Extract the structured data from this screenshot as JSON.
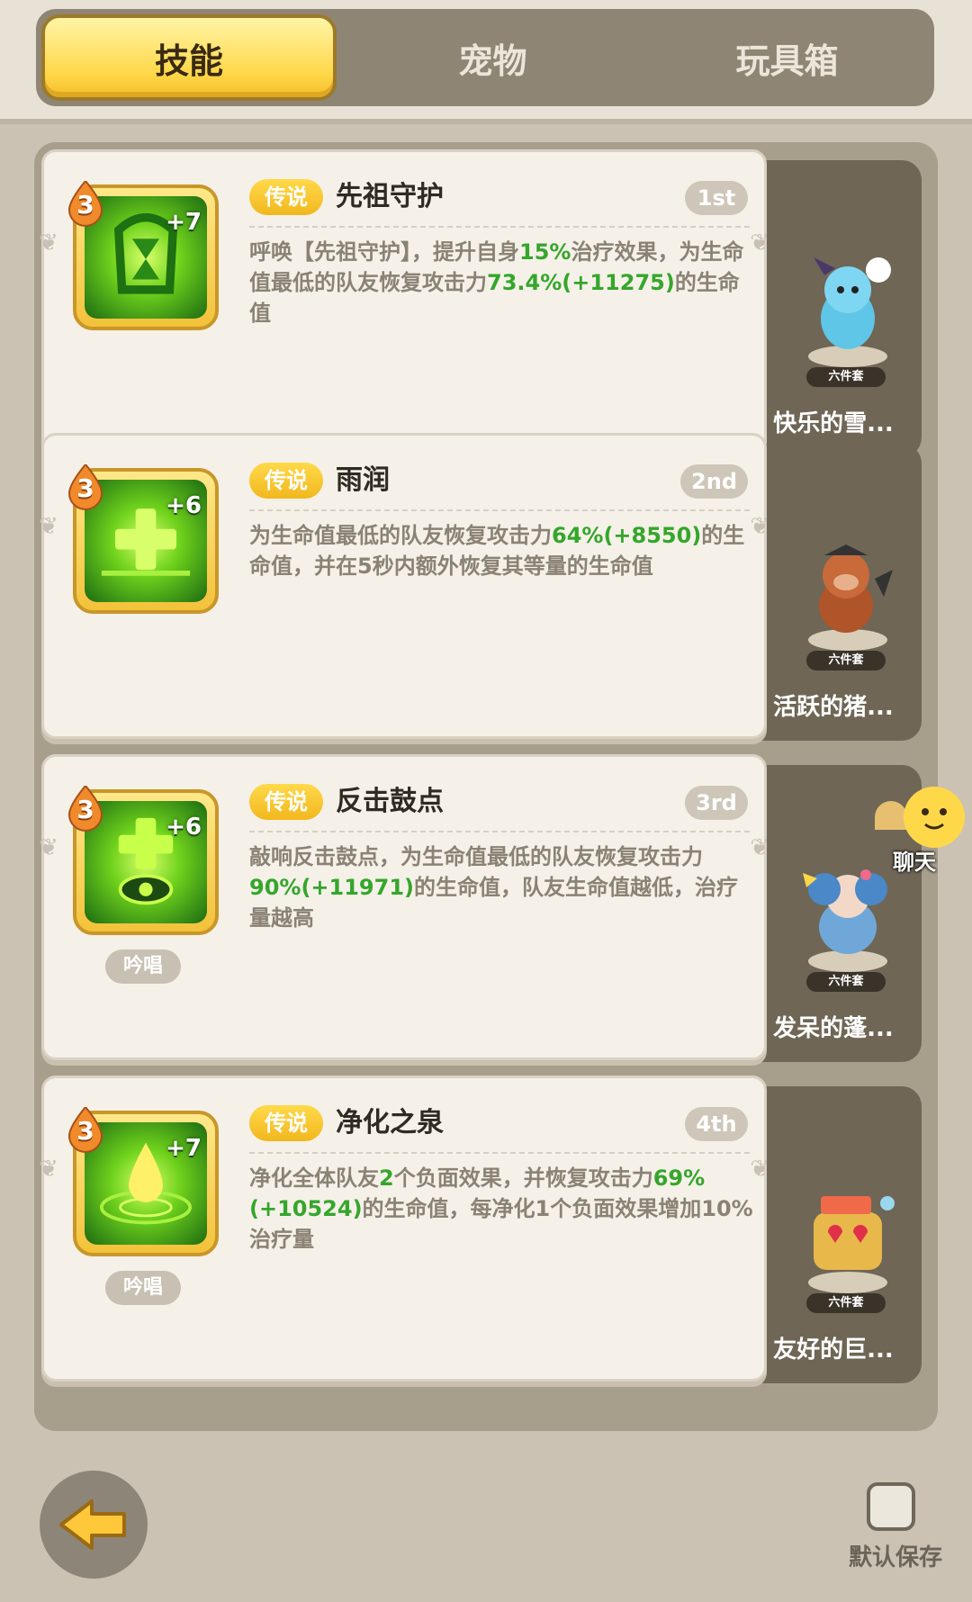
{
  "tabs": [
    {
      "label": "技能",
      "active": true
    },
    {
      "label": "宠物",
      "active": false
    },
    {
      "label": "玩具箱",
      "active": false
    }
  ],
  "skills": [
    {
      "level": "3",
      "plus": "+7",
      "badge": "传说",
      "name": "先祖守护",
      "rank": "1st",
      "chant": "",
      "desc": [
        {
          "t": "呼唤【先祖守护】，提升自身"
        },
        {
          "t": "15%",
          "hl": true
        },
        {
          "t": "治疗效果，为生命值最低的队友恢复攻击力"
        },
        {
          "t": "73.4%(+11275)",
          "hl": true
        },
        {
          "t": "的生命值"
        }
      ],
      "pet": {
        "name": "快乐的雪...",
        "set": "六件套"
      }
    },
    {
      "level": "3",
      "plus": "+6",
      "badge": "传说",
      "name": "雨润",
      "rank": "2nd",
      "chant": "",
      "desc": [
        {
          "t": "为生命值最低的队友恢复攻击力"
        },
        {
          "t": "64%(+8550)",
          "hl": true
        },
        {
          "t": "的生命值，并在5秒内额外恢复其等量的生命值"
        }
      ],
      "pet": {
        "name": "活跃的猪...",
        "set": "六件套"
      }
    },
    {
      "level": "3",
      "plus": "+6",
      "badge": "传说",
      "name": "反击鼓点",
      "rank": "3rd",
      "chant": "吟唱",
      "desc": [
        {
          "t": "敲响反击鼓点，为生命值最低的队友恢复攻击力"
        },
        {
          "t": "90%(+11971)",
          "hl": true
        },
        {
          "t": "的生命值，队友生命值越低，治疗量越高"
        }
      ],
      "pet": {
        "name": "发呆的蓬...",
        "set": "六件套"
      }
    },
    {
      "level": "3",
      "plus": "+7",
      "badge": "传说",
      "name": "净化之泉",
      "rank": "4th",
      "chant": "吟唱",
      "desc": [
        {
          "t": "净化全体队友"
        },
        {
          "t": "2",
          "hl": true
        },
        {
          "t": "个负面效果，并恢复攻击力"
        },
        {
          "t": "69%(+10524)",
          "hl": true
        },
        {
          "t": "的生命值，每净化1个负面效果增加10%治疗量"
        }
      ],
      "pet": {
        "name": "友好的巨...",
        "set": "六件套"
      }
    }
  ],
  "chat": {
    "label": "聊天"
  },
  "bottom": {
    "save_label": "默认保存",
    "save_checked": false
  },
  "colors": {
    "highlight": "#35a62c",
    "tab_active": "#ffd84a",
    "legend_badge": "#f2b71e"
  }
}
